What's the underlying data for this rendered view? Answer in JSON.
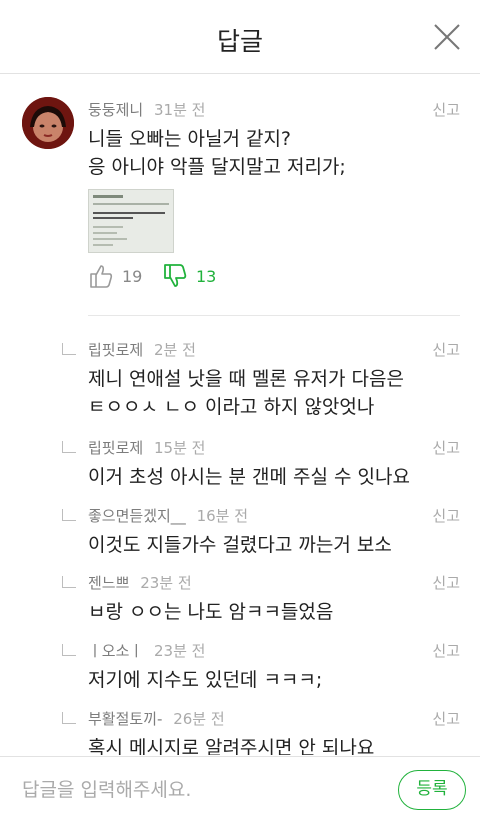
{
  "header": {
    "title": "답글"
  },
  "main_comment": {
    "nickname": "둥둥제니",
    "time": "31분 전",
    "report_label": "신고",
    "lines": [
      "니들 오빠는 아닐거 같지?",
      "응 아니야 악플 달지말고 저리가;"
    ],
    "likes": "19",
    "dislikes": "13"
  },
  "replies": [
    {
      "nickname": "립핏로제",
      "time": "2분 전",
      "report_label": "신고",
      "lines": [
        "제니 연애설 낫을 때 멜론 유저가 다음은",
        "ㅌㅇㅇㅅ ㄴㅇ 이라고 하지 않앗엇나"
      ]
    },
    {
      "nickname": "립핏로제",
      "time": "15분 전",
      "report_label": "신고",
      "lines": [
        "이거 초성 아시는 분 갠메 주실 수 잇나요"
      ]
    },
    {
      "nickname": "좋으면듣겠지__",
      "time": "16분 전",
      "report_label": "신고",
      "lines": [
        "이것도 지들가수 걸렸다고 까는거 보소"
      ]
    },
    {
      "nickname": "젠느쁘",
      "time": "23분 전",
      "report_label": "신고",
      "lines": [
        "ㅂ랑 ㅇㅇ는 나도 암ㅋㅋ들었음"
      ]
    },
    {
      "nickname": "ㅣ오소ㅣ",
      "time": "23분 전",
      "report_label": "신고",
      "lines": [
        "저기에 지수도 있던데 ㅋㅋㅋ;"
      ]
    },
    {
      "nickname": "부활절토끼-",
      "time": "26분 전",
      "report_label": "신고",
      "lines": [
        "혹시 메시지로 알려주시면 안 되나요"
      ]
    }
  ],
  "footer": {
    "placeholder": "답글을 입력해주세요.",
    "submit_label": "등록"
  },
  "colors": {
    "accent": "#21b23c",
    "text": "#222222",
    "muted": "#aaaaaa"
  }
}
